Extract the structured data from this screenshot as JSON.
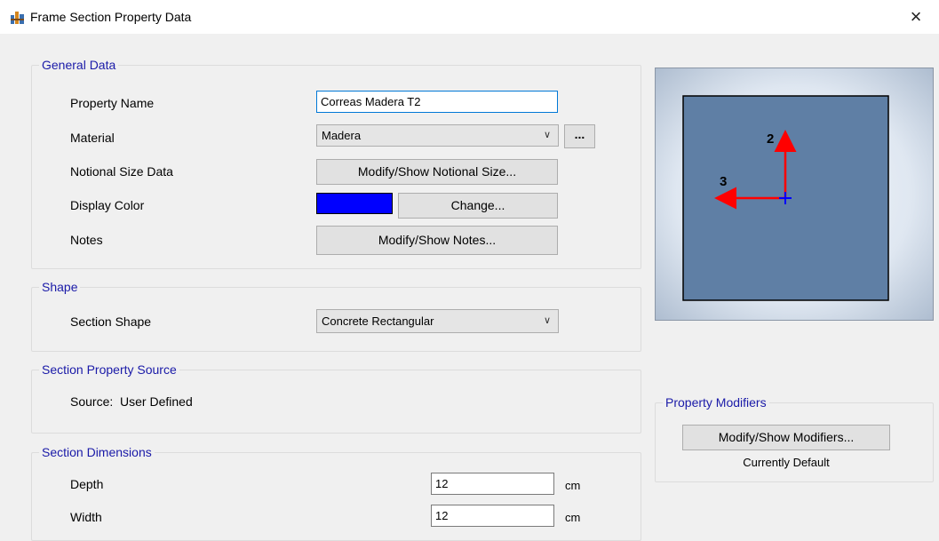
{
  "window": {
    "title": "Frame Section Property Data",
    "close_symbol": "×"
  },
  "general_data": {
    "group_title": "General Data",
    "property_name_label": "Property Name",
    "property_name_value": "Correas Madera T2",
    "material_label": "Material",
    "material_value": "Madera",
    "material_browse_label": "...",
    "notional_label": "Notional Size Data",
    "notional_button": "Modify/Show Notional Size...",
    "display_color_label": "Display Color",
    "display_color": "#0000ff",
    "change_button": "Change...",
    "notes_label": "Notes",
    "notes_button": "Modify/Show Notes..."
  },
  "shape": {
    "group_title": "Shape",
    "section_shape_label": "Section Shape",
    "section_shape_value": "Concrete Rectangular"
  },
  "source": {
    "group_title": "Section Property Source",
    "source_text": "Source:  User Defined"
  },
  "dimensions": {
    "group_title": "Section Dimensions",
    "depth_label": "Depth",
    "depth_value": "12",
    "depth_unit": "cm",
    "width_label": "Width",
    "width_value": "12",
    "width_unit": "cm"
  },
  "preview": {
    "axis_2_label": "2",
    "axis_3_label": "3",
    "section_fill": "#5f7fa5",
    "axis_color": "#ff0000",
    "origin_color": "#0000ff"
  },
  "modifiers": {
    "group_title": "Property Modifiers",
    "button": "Modify/Show Modifiers...",
    "status": "Currently Default"
  }
}
